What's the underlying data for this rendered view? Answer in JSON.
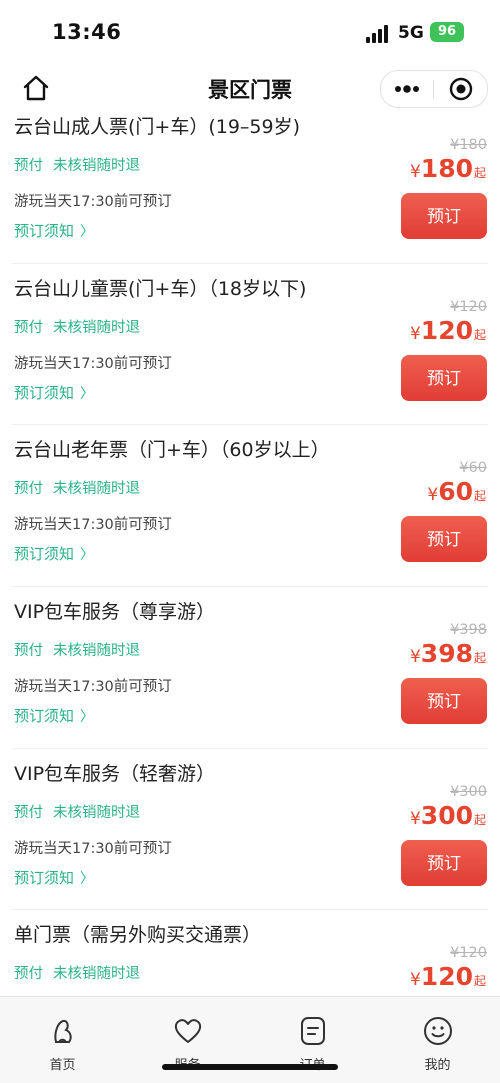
{
  "status_bar": {
    "time": "13:46",
    "network": "5G",
    "battery": "96"
  },
  "nav": {
    "title": "景区门票"
  },
  "tickets": [
    {
      "name": "云台山成人票(门+车）(19–59岁)",
      "tags": [
        "预付",
        "未核销随时退"
      ],
      "deadline": "游玩当天17:30前可预订",
      "notice": "预订须知",
      "original_price": "¥180",
      "currency": "¥",
      "price": "180",
      "price_suffix": "起",
      "button": "预订"
    },
    {
      "name": "云台山儿童票(门+车）（18岁以下)",
      "tags": [
        "预付",
        "未核销随时退"
      ],
      "deadline": "游玩当天17:30前可预订",
      "notice": "预订须知",
      "original_price": "¥120",
      "currency": "¥",
      "price": "120",
      "price_suffix": "起",
      "button": "预订"
    },
    {
      "name": "云台山老年票（门+车）（60岁以上）",
      "tags": [
        "预付",
        "未核销随时退"
      ],
      "deadline": "游玩当天17:30前可预订",
      "notice": "预订须知",
      "original_price": "¥60",
      "currency": "¥",
      "price": "60",
      "price_suffix": "起",
      "button": "预订"
    },
    {
      "name": "VIP包车服务（尊享游）",
      "tags": [
        "预付",
        "未核销随时退"
      ],
      "deadline": "游玩当天17:30前可预订",
      "notice": "预订须知",
      "original_price": "¥398",
      "currency": "¥",
      "price": "398",
      "price_suffix": "起",
      "button": "预订"
    },
    {
      "name": "VIP包车服务（轻奢游）",
      "tags": [
        "预付",
        "未核销随时退"
      ],
      "deadline": "游玩当天17:30前可预订",
      "notice": "预订须知",
      "original_price": "¥300",
      "currency": "¥",
      "price": "300",
      "price_suffix": "起",
      "button": "预订"
    },
    {
      "name": "单门票（需另外购买交通票）",
      "tags": [
        "预付",
        "未核销随时退"
      ],
      "deadline": "",
      "notice": "",
      "original_price": "¥120",
      "currency": "¥",
      "price": "120",
      "price_suffix": "起",
      "button": ""
    }
  ],
  "tab_bar": {
    "items": [
      {
        "label": "首页",
        "icon": "home-icon"
      },
      {
        "label": "服务",
        "icon": "heart-icon"
      },
      {
        "label": "订单",
        "icon": "order-icon"
      },
      {
        "label": "我的",
        "icon": "smiley-icon"
      }
    ]
  },
  "colors": {
    "accent_green": "#2bb38a",
    "price_red": "#e5442e",
    "button_red": "#e13d35"
  }
}
